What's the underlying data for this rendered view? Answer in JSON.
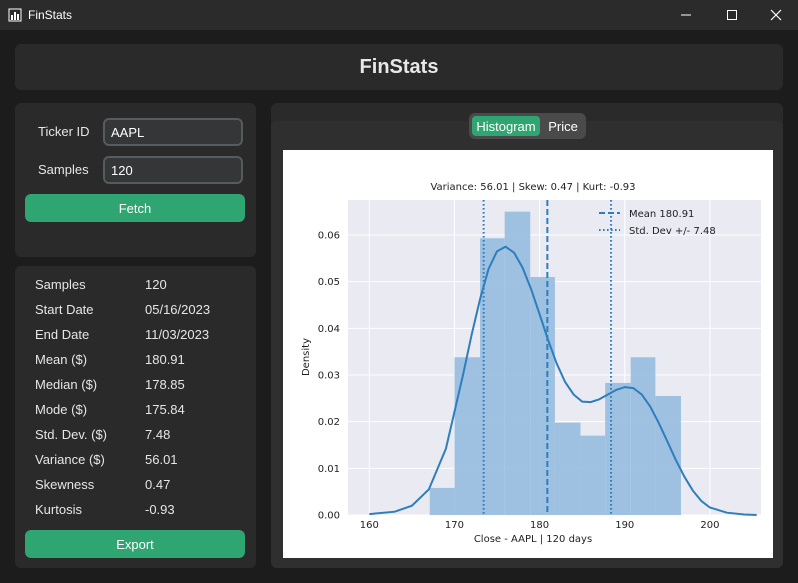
{
  "window": {
    "title": "FinStats",
    "app_icon": "bar-chart-icon",
    "controls": [
      "minimize-icon",
      "maximize-icon",
      "close-icon"
    ]
  },
  "header": {
    "title": "FinStats"
  },
  "inputs": {
    "ticker_label": "Ticker ID",
    "ticker_value": "AAPL",
    "samples_label": "Samples",
    "samples_value": "120",
    "fetch_label": "Fetch"
  },
  "stats": [
    {
      "label": "Samples",
      "value": "120"
    },
    {
      "label": "Start Date",
      "value": "05/16/2023"
    },
    {
      "label": "End Date",
      "value": "11/03/2023"
    },
    {
      "label": "Mean ($)",
      "value": "180.91"
    },
    {
      "label": "Median ($)",
      "value": "178.85"
    },
    {
      "label": "Mode ($)",
      "value": "175.84"
    },
    {
      "label": "Std. Dev. ($)",
      "value": "7.48"
    },
    {
      "label": "Variance ($)",
      "value": "56.01"
    },
    {
      "label": "Skewness",
      "value": "0.47"
    },
    {
      "label": "Kurtosis",
      "value": "-0.93"
    }
  ],
  "export_label": "Export",
  "tabs": {
    "histogram": "Histogram",
    "price": "Price",
    "active": "Histogram"
  },
  "colors": {
    "accent": "#2fa572",
    "bar": "#9bbfdf",
    "line": "#2e7ebc",
    "plot_bg": "#eaeaf2"
  },
  "chart_data": {
    "type": "bar",
    "title": "Variance: 56.01 | Skew: 0.47 | Kurt: -0.93",
    "xlabel": "Close - AAPL | 120 days",
    "ylabel": "Density",
    "xlim": [
      157.5,
      206
    ],
    "ylim": [
      0,
      0.0675
    ],
    "xticks": [
      160,
      170,
      180,
      190,
      200
    ],
    "yticks": [
      0.0,
      0.01,
      0.02,
      0.03,
      0.04,
      0.05,
      0.06
    ],
    "ytick_labels": [
      "0.00",
      "0.01",
      "0.02",
      "0.03",
      "0.04",
      "0.05",
      "0.06"
    ],
    "bins": [
      {
        "x0": 167.1,
        "x1": 170.0,
        "density": 0.0058
      },
      {
        "x0": 170.0,
        "x1": 173.0,
        "density": 0.0338
      },
      {
        "x0": 173.0,
        "x1": 175.9,
        "density": 0.0593
      },
      {
        "x0": 175.9,
        "x1": 178.9,
        "density": 0.065
      },
      {
        "x0": 178.9,
        "x1": 181.8,
        "density": 0.051
      },
      {
        "x0": 181.8,
        "x1": 184.8,
        "density": 0.0198
      },
      {
        "x0": 184.8,
        "x1": 187.7,
        "density": 0.017
      },
      {
        "x0": 187.7,
        "x1": 190.7,
        "density": 0.0283
      },
      {
        "x0": 190.7,
        "x1": 193.6,
        "density": 0.0338
      },
      {
        "x0": 193.6,
        "x1": 196.6,
        "density": 0.0255
      }
    ],
    "kde": {
      "x": [
        160,
        163,
        165,
        167,
        169,
        171,
        172,
        173,
        174,
        175,
        176,
        177,
        178,
        179,
        180,
        181,
        182,
        183,
        184,
        185,
        186,
        187,
        188,
        189,
        190,
        191,
        192,
        193,
        194,
        195,
        196,
        197,
        198,
        199,
        200,
        202,
        204,
        205.5
      ],
      "y": [
        0.0002,
        0.0007,
        0.002,
        0.0055,
        0.0142,
        0.03,
        0.0385,
        0.0462,
        0.0527,
        0.0565,
        0.0575,
        0.0562,
        0.053,
        0.0484,
        0.043,
        0.0375,
        0.0325,
        0.0285,
        0.0258,
        0.0243,
        0.0242,
        0.0248,
        0.0258,
        0.0268,
        0.0274,
        0.0272,
        0.0258,
        0.0232,
        0.0197,
        0.0158,
        0.0118,
        0.0082,
        0.0052,
        0.003,
        0.0016,
        0.0005,
        0.0001,
        0.0
      ]
    },
    "mean": 180.91,
    "std_lines": [
      173.43,
      188.39
    ],
    "legend": {
      "placement": "top-right",
      "mean_label": "Mean 180.91",
      "std_label": "Std. Dev +/- 7.48"
    }
  }
}
